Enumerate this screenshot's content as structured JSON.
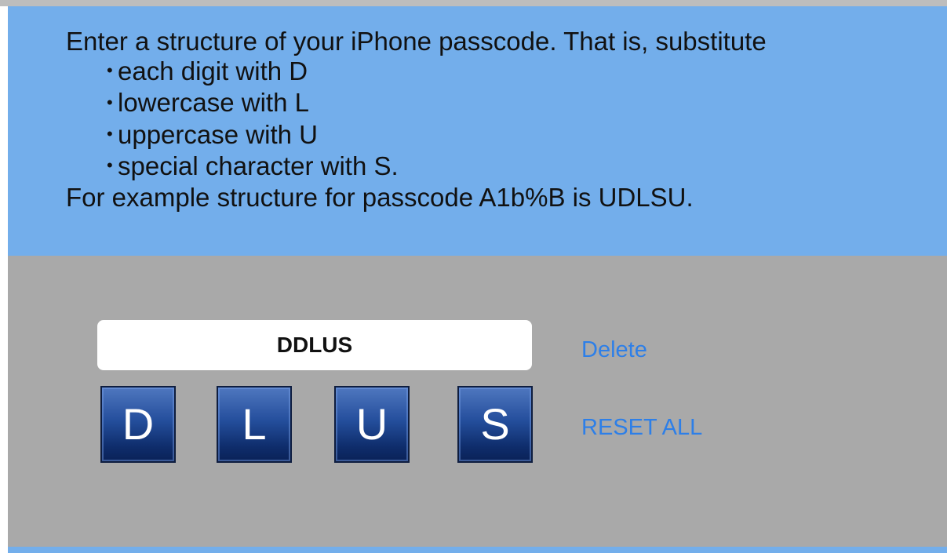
{
  "instructions": {
    "intro": "Enter a structure of your iPhone passcode. That is, substitute",
    "bullets": [
      "each digit with D",
      "lowercase with L",
      "uppercase with U",
      "special character with S."
    ],
    "example": "For example structure for passcode A1b%B is UDLSU."
  },
  "entry": {
    "structure_value": "DDLUS",
    "keys": [
      "D",
      "L",
      "U",
      "S"
    ],
    "delete_label": "Delete",
    "reset_label": "RESET ALL"
  },
  "colors": {
    "instruction_bg": "#73aeeb",
    "panel_bg": "#a9a9a9",
    "key_bg": "#244e9c",
    "link": "#2d7fe8"
  }
}
